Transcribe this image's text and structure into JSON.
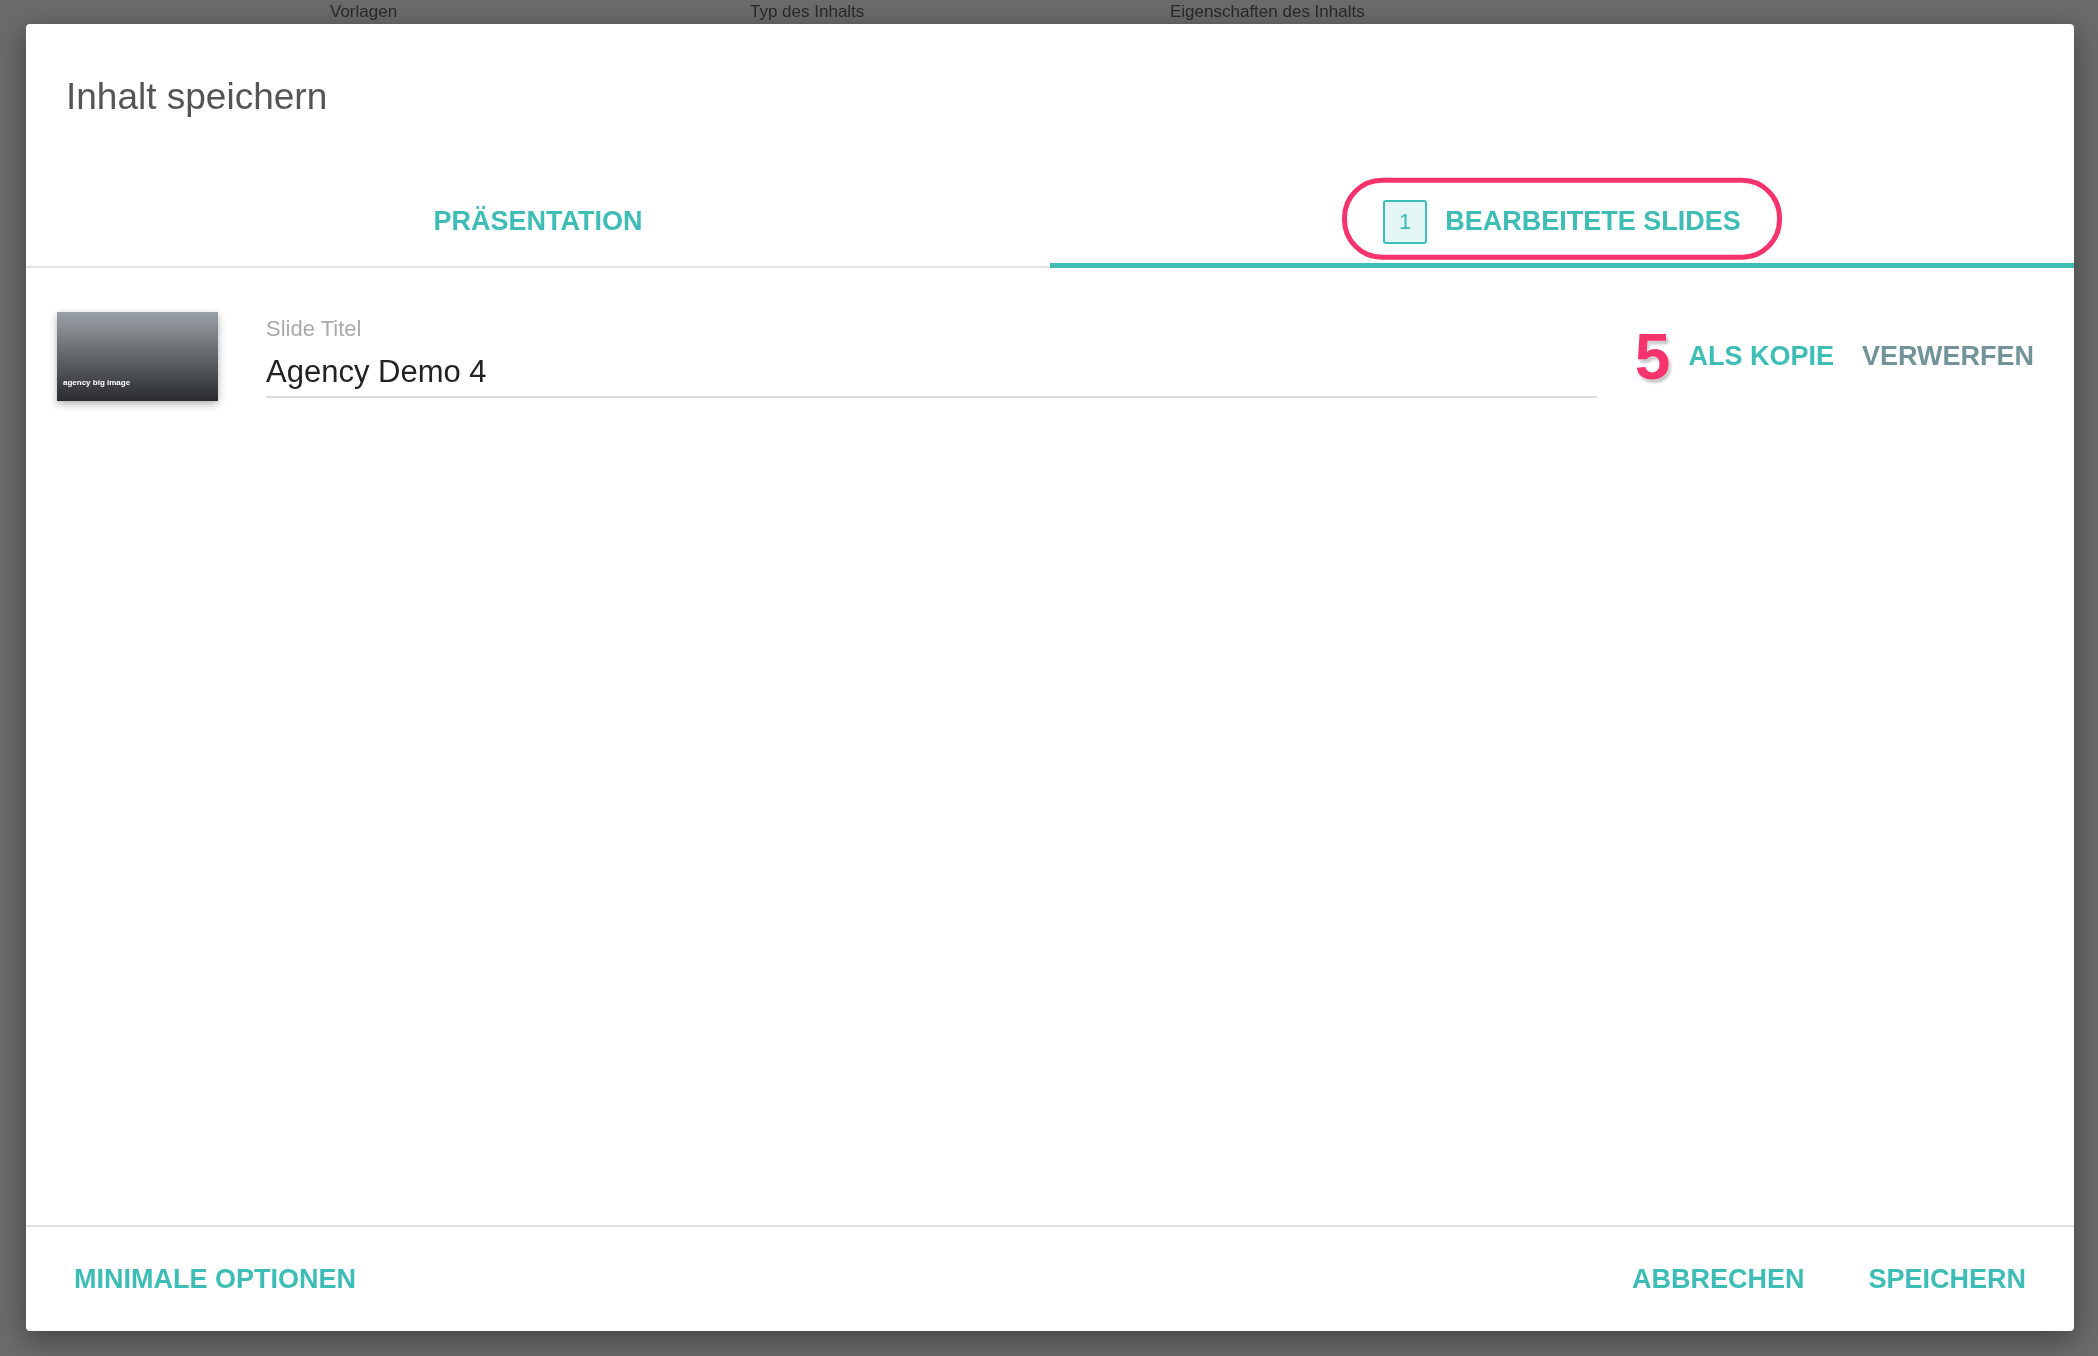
{
  "background": {
    "columns": [
      "Vorlagen",
      "Typ des Inhalts",
      "Eigenschaften des Inhalts"
    ]
  },
  "dialog": {
    "title": "Inhalt speichern",
    "tabs": [
      {
        "label": "PRÄSENTATION",
        "selected": false
      },
      {
        "label": "BEARBEITETE SLIDES",
        "selected": true,
        "count": "1",
        "highlighted": true
      }
    ],
    "slides": [
      {
        "thumbnail": {
          "caption": "agency big image"
        },
        "field_label": "Slide Titel",
        "value": "Agency Demo 4",
        "step_number": "5",
        "actions": [
          {
            "label": "ALS KOPIE",
            "kind": "primary"
          },
          {
            "label": "VERWERFEN",
            "kind": "secondary"
          }
        ]
      }
    ],
    "footer": {
      "left": "MINIMALE OPTIONEN",
      "buttons": [
        "ABBRECHEN",
        "SPEICHERN"
      ]
    }
  }
}
